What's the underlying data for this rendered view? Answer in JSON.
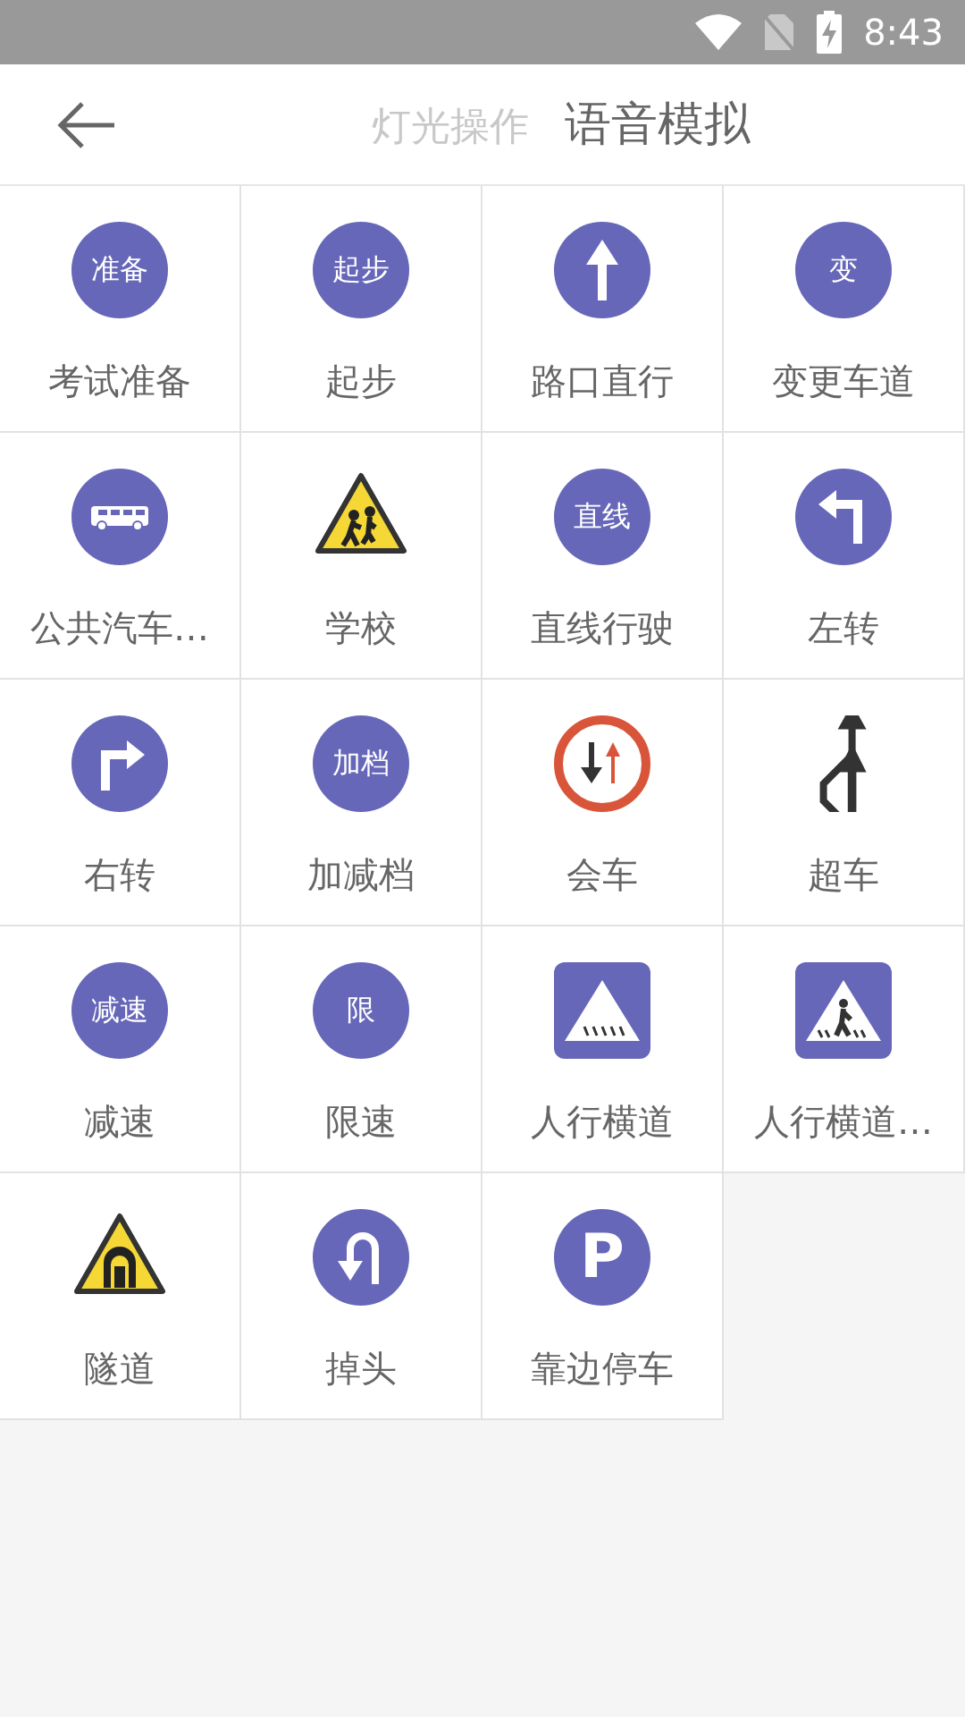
{
  "status_bar": {
    "time": "8:43"
  },
  "header": {
    "tabs": [
      {
        "label": "灯光操作",
        "selected": false
      },
      {
        "label": "语音模拟",
        "selected": true
      }
    ]
  },
  "items": [
    {
      "kind": "text_circle",
      "sign_text": "准备",
      "label": "考试准备"
    },
    {
      "kind": "text_circle",
      "sign_text": "起步",
      "label": "起步"
    },
    {
      "kind": "arrow_up",
      "label": "路口直行"
    },
    {
      "kind": "text_circle",
      "sign_text": "变",
      "label": "变更车道"
    },
    {
      "kind": "bus",
      "label": "公共汽车…"
    },
    {
      "kind": "school",
      "label": "学校"
    },
    {
      "kind": "text_circle",
      "sign_text": "直线",
      "label": "直线行驶"
    },
    {
      "kind": "left_turn",
      "label": "左转"
    },
    {
      "kind": "right_turn",
      "label": "右转"
    },
    {
      "kind": "text_circle",
      "sign_text": "加档",
      "label": "加减档"
    },
    {
      "kind": "meet",
      "label": "会车"
    },
    {
      "kind": "overtake",
      "label": "超车"
    },
    {
      "kind": "text_circle",
      "sign_text": "减速",
      "label": "减速"
    },
    {
      "kind": "text_circle",
      "sign_text": "限",
      "label": "限速"
    },
    {
      "kind": "crosswalk",
      "label": "人行横道"
    },
    {
      "kind": "crosswalk_person",
      "label": "人行横道…"
    },
    {
      "kind": "tunnel",
      "label": "隧道"
    },
    {
      "kind": "u_turn",
      "label": "掉头"
    },
    {
      "kind": "text_circle",
      "sign_text": "P",
      "label": "靠边停车"
    }
  ]
}
